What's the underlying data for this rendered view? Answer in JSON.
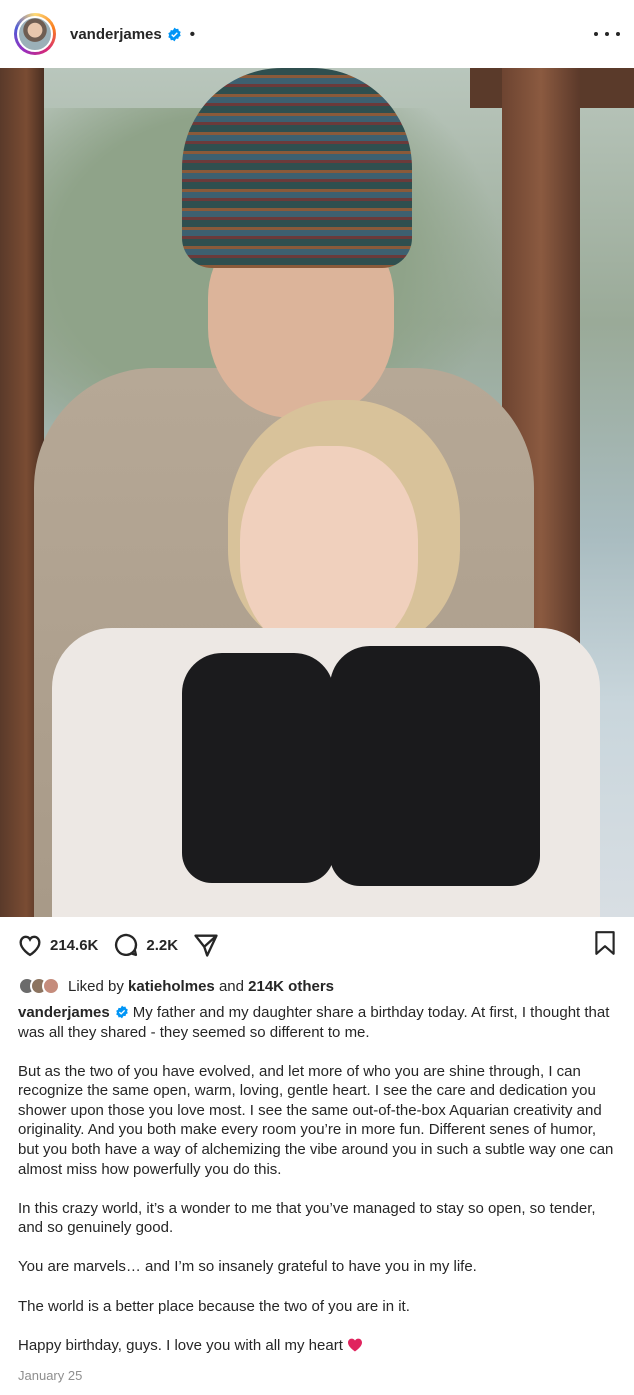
{
  "header": {
    "username": "vanderjames",
    "separator": "•",
    "more_icon": "more-horizontal-icon",
    "verified_icon": "verified-badge-icon"
  },
  "post": {
    "image_alt": "Photo of a man in a striped beanie hugging a girl wearing black gloves on a porch"
  },
  "actions": {
    "like_count": "214.6K",
    "comment_count": "2.2K",
    "icons": [
      "heart-icon",
      "comment-icon",
      "share-icon",
      "bookmark-icon"
    ]
  },
  "likes": {
    "prefix": "Liked by",
    "user": "katieholmes",
    "conjunction": "and",
    "others": "214K others"
  },
  "caption": {
    "username": "vanderjames",
    "paragraphs": [
      "My father and my daughter share a birthday today. At first, I thought that was all they shared - they seemed so different to me.",
      "But as the two of you have evolved, and let more of who you are shine through, I can recognize the same open, warm, loving, gentle heart. I see the care and dedication you shower upon those you love most. I see the same out-of-the-box Aquarian creativity and originality. And you both make every room you’re in more fun. Different senes of humor, but you both have a way of alchemizing the vibe around you in such a subtle way one can almost miss how powerfully you do this.",
      "In this crazy world, it’s a wonder to me that you’ve managed to stay so open, so tender, and so genuinely good.",
      "You are marvels… and I’m so insanely grateful to have you in my life.",
      "The world is a better place because the two of you are in it.",
      "Happy birthday, guys. I love you with all my heart"
    ]
  },
  "date": "January 25",
  "colors": {
    "text": "#262626",
    "muted": "#8e8e8e",
    "verified": "#0095f6",
    "heart_emoji": "#e0245e"
  }
}
